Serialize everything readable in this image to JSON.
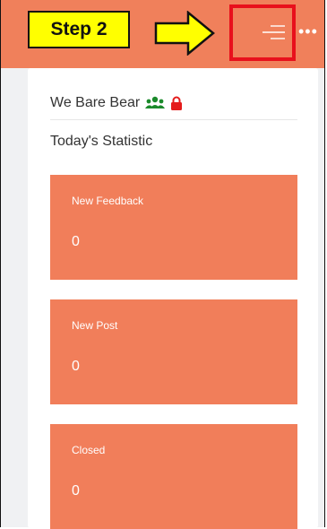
{
  "annotation": {
    "step_label": "Step 2"
  },
  "header": {
    "menu_icon": "menu-lines-icon",
    "more_icon": "more-dots-icon",
    "more_symbol": "•••",
    "bar_color": "#f0805b"
  },
  "brand": {
    "name": "We Bare Bear",
    "group_icon": "users-group-icon",
    "lock_icon": "lock-icon"
  },
  "section": {
    "title": "Today's Statistic"
  },
  "stats": [
    {
      "label": "New Feedback",
      "value": "0"
    },
    {
      "label": "New Post",
      "value": "0"
    },
    {
      "label": "Closed",
      "value": "0"
    }
  ],
  "colors": {
    "accent": "#f17e5a",
    "highlight": "#e8101c",
    "callout": "#ffff00"
  }
}
